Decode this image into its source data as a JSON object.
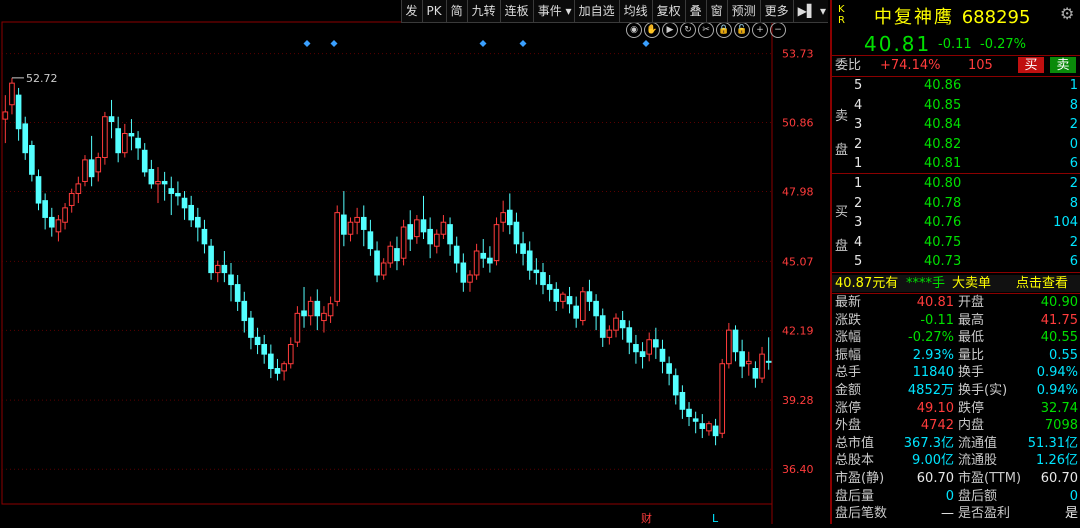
{
  "toolbar": {
    "items": [
      "发",
      "PK",
      "简",
      "九转",
      "连板",
      "事件",
      "加自选",
      "均线",
      "复权",
      "叠",
      "窗",
      "预测",
      "更多"
    ],
    "menu_arrow": "▾",
    "page_icon": "▶▌"
  },
  "chart_icons": [
    "eye-icon",
    "hand-icon",
    "play-icon",
    "refresh-icon",
    "scissors-icon",
    "lock-icon",
    "lock2-icon",
    "zoom-in-icon",
    "zoom-out-icon"
  ],
  "chart": {
    "price_labels": [
      "53.73",
      "50.86",
      "47.98",
      "45.07",
      "42.19",
      "39.28",
      "36.40"
    ],
    "high_marker": "52.72",
    "bottom_markers": [
      "财",
      "L"
    ]
  },
  "chart_data": {
    "type": "candlestick",
    "ylim": [
      34.95,
      55.05
    ],
    "up_color": "#ff3c3c",
    "down_color": "#54ffff",
    "candles": [
      [
        51.0,
        52.0,
        51.3,
        50.0
      ],
      [
        51.6,
        52.72,
        52.5,
        51.2
      ],
      [
        52.0,
        52.3,
        50.6,
        50.1
      ],
      [
        50.8,
        51.1,
        49.6,
        49.3
      ],
      [
        49.9,
        50.1,
        48.7,
        48.4
      ],
      [
        48.6,
        48.9,
        47.5,
        47.2
      ],
      [
        47.6,
        47.9,
        46.9,
        46.4
      ],
      [
        46.9,
        47.3,
        46.5,
        46.1
      ],
      [
        46.3,
        47.0,
        46.8,
        45.9
      ],
      [
        46.7,
        47.5,
        47.3,
        46.4
      ],
      [
        47.4,
        48.1,
        47.9,
        47.1
      ],
      [
        47.9,
        48.6,
        48.3,
        47.5
      ],
      [
        48.4,
        49.5,
        49.3,
        48.2
      ],
      [
        49.3,
        50.3,
        48.6,
        48.2
      ],
      [
        48.8,
        49.6,
        49.4,
        48.4
      ],
      [
        49.4,
        51.3,
        51.1,
        49.1
      ],
      [
        51.1,
        51.8,
        50.9,
        50.2
      ],
      [
        50.6,
        51.1,
        49.6,
        49.2
      ],
      [
        49.6,
        50.8,
        50.4,
        49.4
      ],
      [
        50.4,
        51.0,
        50.3,
        49.7
      ],
      [
        50.2,
        50.5,
        49.8,
        49.3
      ],
      [
        49.7,
        50.0,
        48.8,
        48.6
      ],
      [
        48.9,
        49.3,
        48.3,
        48.1
      ],
      [
        48.3,
        49.0,
        48.4,
        47.5
      ],
      [
        48.4,
        48.8,
        48.3,
        47.6
      ],
      [
        48.1,
        48.6,
        47.9,
        47.0
      ],
      [
        47.9,
        48.4,
        47.8,
        47.4
      ],
      [
        47.7,
        48.0,
        47.3,
        46.8
      ],
      [
        47.4,
        47.8,
        46.8,
        46.5
      ],
      [
        46.9,
        47.3,
        46.5,
        45.9
      ],
      [
        46.4,
        46.8,
        45.8,
        45.4
      ],
      [
        45.7,
        46.0,
        44.6,
        44.3
      ],
      [
        44.6,
        45.1,
        44.9,
        44.2
      ],
      [
        44.9,
        45.5,
        44.6,
        44.2
      ],
      [
        44.5,
        45.0,
        44.1,
        43.4
      ],
      [
        44.1,
        44.5,
        43.4,
        43.0
      ],
      [
        43.4,
        43.8,
        42.6,
        42.1
      ],
      [
        42.7,
        43.0,
        41.9,
        41.4
      ],
      [
        41.9,
        42.3,
        41.6,
        41.2
      ],
      [
        41.6,
        42.0,
        41.2,
        40.8
      ],
      [
        41.2,
        41.6,
        40.6,
        40.2
      ],
      [
        40.6,
        41.0,
        40.4,
        40.1
      ],
      [
        40.5,
        40.9,
        40.8,
        40.1
      ],
      [
        40.8,
        41.9,
        41.6,
        40.6
      ],
      [
        41.7,
        43.2,
        42.9,
        41.5
      ],
      [
        43.0,
        44.0,
        42.8,
        42.3
      ],
      [
        42.8,
        43.6,
        43.4,
        42.4
      ],
      [
        43.4,
        43.9,
        42.8,
        42.2
      ],
      [
        42.6,
        43.2,
        42.9,
        42.1
      ],
      [
        42.8,
        43.6,
        43.3,
        42.5
      ],
      [
        43.4,
        47.4,
        47.1,
        43.2
      ],
      [
        47.0,
        48.0,
        46.2,
        45.7
      ],
      [
        46.2,
        46.9,
        46.7,
        45.9
      ],
      [
        46.7,
        47.3,
        46.9,
        46.2
      ],
      [
        46.9,
        47.4,
        46.4,
        45.7
      ],
      [
        46.3,
        46.8,
        45.6,
        45.3
      ],
      [
        45.5,
        45.9,
        44.5,
        44.2
      ],
      [
        44.5,
        45.2,
        45.0,
        44.3
      ],
      [
        45.0,
        45.9,
        45.7,
        44.8
      ],
      [
        45.6,
        46.1,
        45.1,
        44.7
      ],
      [
        45.2,
        46.8,
        46.5,
        44.9
      ],
      [
        46.6,
        47.2,
        46.0,
        45.5
      ],
      [
        46.1,
        47.0,
        46.8,
        45.8
      ],
      [
        46.8,
        47.8,
        46.3,
        46.0
      ],
      [
        46.4,
        46.9,
        45.8,
        45.2
      ],
      [
        45.7,
        46.4,
        46.2,
        45.4
      ],
      [
        46.2,
        47.0,
        46.7,
        46.0
      ],
      [
        46.6,
        46.9,
        45.8,
        45.3
      ],
      [
        45.7,
        46.1,
        45.0,
        44.6
      ],
      [
        45.0,
        45.4,
        44.2,
        43.8
      ],
      [
        44.2,
        44.7,
        44.5,
        43.8
      ],
      [
        44.5,
        45.8,
        45.5,
        44.3
      ],
      [
        45.4,
        46.0,
        45.2,
        44.8
      ],
      [
        45.2,
        45.7,
        45.0,
        44.6
      ],
      [
        45.1,
        46.9,
        46.6,
        44.9
      ],
      [
        46.7,
        47.6,
        47.1,
        46.3
      ],
      [
        47.2,
        47.9,
        46.6,
        46.2
      ],
      [
        46.7,
        47.1,
        45.8,
        45.4
      ],
      [
        45.8,
        46.3,
        45.4,
        44.9
      ],
      [
        45.5,
        45.9,
        44.7,
        44.3
      ],
      [
        44.7,
        45.2,
        44.6,
        44.1
      ],
      [
        44.6,
        45.0,
        44.1,
        43.7
      ],
      [
        44.1,
        44.5,
        43.9,
        43.4
      ],
      [
        43.9,
        44.2,
        43.4,
        43.0
      ],
      [
        43.4,
        43.8,
        43.7,
        43.1
      ],
      [
        43.6,
        44.0,
        43.3,
        42.9
      ],
      [
        43.2,
        43.6,
        42.7,
        42.3
      ],
      [
        42.6,
        44.0,
        43.8,
        42.4
      ],
      [
        43.8,
        44.3,
        43.4,
        43.0
      ],
      [
        43.4,
        43.7,
        42.8,
        42.2
      ],
      [
        42.8,
        43.1,
        41.9,
        41.5
      ],
      [
        41.9,
        42.4,
        42.2,
        41.6
      ],
      [
        42.2,
        42.9,
        42.7,
        41.9
      ],
      [
        42.6,
        43.0,
        42.3,
        41.8
      ],
      [
        42.3,
        42.6,
        41.7,
        41.2
      ],
      [
        41.6,
        42.0,
        41.3,
        40.8
      ],
      [
        41.3,
        41.7,
        41.1,
        40.6
      ],
      [
        41.2,
        42.1,
        41.8,
        40.9
      ],
      [
        41.8,
        42.3,
        41.5,
        41.0
      ],
      [
        41.4,
        41.8,
        40.9,
        40.4
      ],
      [
        40.8,
        41.1,
        40.4,
        39.9
      ],
      [
        40.3,
        40.6,
        39.5,
        39.1
      ],
      [
        39.6,
        39.9,
        38.9,
        38.5
      ],
      [
        38.9,
        39.2,
        38.6,
        38.2
      ],
      [
        38.5,
        38.8,
        38.4,
        37.9
      ],
      [
        38.3,
        38.7,
        38.1,
        37.7
      ],
      [
        38.0,
        38.4,
        38.3,
        37.8
      ],
      [
        38.2,
        38.5,
        37.8,
        37.4
      ],
      [
        37.9,
        41.0,
        40.8,
        37.7
      ],
      [
        40.8,
        42.5,
        42.2,
        40.6
      ],
      [
        42.2,
        42.4,
        41.3,
        40.9
      ],
      [
        41.3,
        41.8,
        40.7,
        40.2
      ],
      [
        40.8,
        41.3,
        40.9,
        40.3
      ],
      [
        40.6,
        40.9,
        40.2,
        39.8
      ],
      [
        40.2,
        41.5,
        41.2,
        40.0
      ],
      [
        40.9,
        41.9,
        40.87,
        40.55
      ]
    ]
  },
  "quote": {
    "name": "中复神鹰",
    "code": "688295",
    "badge_k": "K",
    "badge_r": "R",
    "price": "40.81",
    "change": "-0.11",
    "pct": "-0.27%",
    "weibi_label": "委比",
    "weibi": "+74.14%",
    "weicha": "105",
    "buy_btn": "买",
    "sell_btn": "卖"
  },
  "asks": [
    {
      "level": "5",
      "price": "40.86",
      "vol": "1"
    },
    {
      "level": "4",
      "price": "40.85",
      "vol": "8"
    },
    {
      "level": "3",
      "price": "40.84",
      "vol": "2"
    },
    {
      "level": "2",
      "price": "40.82",
      "vol": "0"
    },
    {
      "level": "1",
      "price": "40.81",
      "vol": "6"
    }
  ],
  "ask_label": [
    "卖",
    "盘"
  ],
  "bids": [
    {
      "level": "1",
      "price": "40.80",
      "vol": "2"
    },
    {
      "level": "2",
      "price": "40.78",
      "vol": "8"
    },
    {
      "level": "3",
      "price": "40.76",
      "vol": "104"
    },
    {
      "level": "4",
      "price": "40.75",
      "vol": "2"
    },
    {
      "level": "5",
      "price": "40.73",
      "vol": "6"
    }
  ],
  "bid_label": [
    "买",
    "盘"
  ],
  "big_order": {
    "price": "40.87元有",
    "hands": "****手",
    "label": "大卖单",
    "action": "点击查看"
  },
  "stats": [
    {
      "l1": "最新",
      "v1": "40.81",
      "c1": "red",
      "l2": "开盘",
      "v2": "40.90",
      "c2": "green"
    },
    {
      "l1": "涨跌",
      "v1": "-0.11",
      "c1": "green",
      "l2": "最高",
      "v2": "41.75",
      "c2": "red"
    },
    {
      "l1": "涨幅",
      "v1": "-0.27%",
      "c1": "green",
      "l2": "最低",
      "v2": "40.55",
      "c2": "green"
    },
    {
      "l1": "振幅",
      "v1": "2.93%",
      "c1": "cyan",
      "l2": "量比",
      "v2": "0.55",
      "c2": "cyan"
    },
    {
      "l1": "总手",
      "v1": "11840",
      "c1": "cyan",
      "l2": "换手",
      "v2": "0.94%",
      "c2": "cyan"
    },
    {
      "l1": "金额",
      "v1": "4852万",
      "c1": "cyan",
      "l2": "换手(实)",
      "v2": "0.94%",
      "c2": "cyan"
    },
    {
      "l1": "涨停",
      "v1": "49.10",
      "c1": "red",
      "l2": "跌停",
      "v2": "32.74",
      "c2": "green"
    },
    {
      "l1": "外盘",
      "v1": "4742",
      "c1": "red",
      "l2": "内盘",
      "v2": "7098",
      "c2": "green"
    },
    {
      "l1": "总市值",
      "v1": "367.3亿",
      "c1": "cyan",
      "l2": "流通值",
      "v2": "51.31亿",
      "c2": "cyan"
    },
    {
      "l1": "总股本",
      "v1": "9.00亿",
      "c1": "cyan",
      "l2": "流通股",
      "v2": "1.26亿",
      "c2": "cyan"
    },
    {
      "l1": "市盈(静)",
      "v1": "60.70",
      "c1": "white",
      "l2": "市盈(TTM)",
      "v2": "60.70",
      "c2": "white"
    },
    {
      "l1": "盘后量",
      "v1": "0",
      "c1": "cyan",
      "l2": "盘后额",
      "v2": "0",
      "c2": "cyan"
    },
    {
      "l1": "盘后笔数",
      "v1": "—",
      "c1": "white",
      "l2": "是否盈利",
      "v2": "是",
      "c2": "white"
    }
  ]
}
